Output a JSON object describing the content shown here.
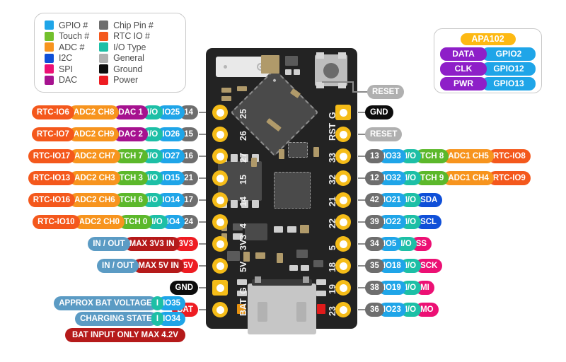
{
  "legend": {
    "left": [
      {
        "label": "GPIO #",
        "color": "#1FA5E8"
      },
      {
        "label": "Touch #",
        "color": "#72C02C"
      },
      {
        "label": "ADC #",
        "color": "#F7941E"
      },
      {
        "label": "I2C",
        "color": "#0F4FD8"
      },
      {
        "label": "SPI",
        "color": "#EC1074"
      },
      {
        "label": "DAC",
        "color": "#A6128F"
      }
    ],
    "right": [
      {
        "label": "Chip Pin #",
        "color": "#6E6E6E"
      },
      {
        "label": "RTC IO #",
        "color": "#F4581C"
      },
      {
        "label": "I/O Type",
        "color": "#1DBFA6"
      },
      {
        "label": "General",
        "color": "#B0B0B0"
      },
      {
        "label": "Ground",
        "color": "#0d0d0d"
      },
      {
        "label": "Power",
        "color": "#EE1C22"
      }
    ]
  },
  "apa102": {
    "title": "APA102",
    "rows": [
      {
        "signal": "DATA",
        "gpio": "GPIO2"
      },
      {
        "signal": "CLK",
        "gpio": "GPIO12"
      },
      {
        "signal": "PWR",
        "gpio": "GPIO13"
      }
    ]
  },
  "board": {
    "reset_callout": "RESET",
    "left_pin_labels": [
      "25",
      "26",
      "27",
      "15",
      "14",
      "4",
      "3V3",
      "5V",
      "G",
      "BAT"
    ],
    "right_pin_labels": [
      "G",
      "RST",
      "33",
      "32",
      "21",
      "22",
      "5",
      "18",
      "19",
      "23"
    ]
  },
  "left_rows": [
    {
      "chips": [
        {
          "t": "RTC-IO6",
          "c": "c-rtc"
        },
        {
          "t": "ADC2 CH8",
          "c": "c-adc"
        },
        {
          "t": "DAC 1",
          "c": "c-dac"
        },
        {
          "t": "I/O",
          "c": "c-io"
        },
        {
          "t": "IO25",
          "c": "c-gpio"
        },
        {
          "t": "14",
          "c": "c-pin"
        }
      ]
    },
    {
      "chips": [
        {
          "t": "RTC-IO7",
          "c": "c-rtc"
        },
        {
          "t": "ADC2 CH9",
          "c": "c-adc"
        },
        {
          "t": "DAC 2",
          "c": "c-dac"
        },
        {
          "t": "I/O",
          "c": "c-io"
        },
        {
          "t": "IO26",
          "c": "c-gpio"
        },
        {
          "t": "15",
          "c": "c-pin"
        }
      ]
    },
    {
      "chips": [
        {
          "t": "RTC-IO17",
          "c": "c-rtc"
        },
        {
          "t": "ADC2 CH7",
          "c": "c-adc"
        },
        {
          "t": "TCH 7",
          "c": "c-tch"
        },
        {
          "t": "I/O",
          "c": "c-io"
        },
        {
          "t": "IO27",
          "c": "c-gpio"
        },
        {
          "t": "16",
          "c": "c-pin"
        }
      ]
    },
    {
      "chips": [
        {
          "t": "RTC-IO13",
          "c": "c-rtc"
        },
        {
          "t": "ADC2 CH3",
          "c": "c-adc"
        },
        {
          "t": "TCH 3",
          "c": "c-tch"
        },
        {
          "t": "I/O",
          "c": "c-io"
        },
        {
          "t": "IO15",
          "c": "c-gpio"
        },
        {
          "t": "21",
          "c": "c-pin"
        }
      ]
    },
    {
      "chips": [
        {
          "t": "RTC-IO16",
          "c": "c-rtc"
        },
        {
          "t": "ADC2 CH6",
          "c": "c-adc"
        },
        {
          "t": "TCH 6",
          "c": "c-tch"
        },
        {
          "t": "I/O",
          "c": "c-io"
        },
        {
          "t": "IO14",
          "c": "c-gpio"
        },
        {
          "t": "17",
          "c": "c-pin"
        }
      ]
    },
    {
      "chips": [
        {
          "t": "RTC-IO10",
          "c": "c-rtc"
        },
        {
          "t": "ADC2 CH0",
          "c": "c-adc"
        },
        {
          "t": "TCH 0",
          "c": "c-tch"
        },
        {
          "t": "I/O",
          "c": "c-io"
        },
        {
          "t": "IO4",
          "c": "c-gpio"
        },
        {
          "t": "24",
          "c": "c-pin"
        }
      ]
    },
    {
      "chips": [
        {
          "t": "IN / OUT",
          "c": "c-inout"
        },
        {
          "t": "MAX 3V3 IN",
          "c": "c-pwrdk"
        },
        {
          "t": "3V3",
          "c": "c-pwr"
        }
      ]
    },
    {
      "chips": [
        {
          "t": "IN / OUT",
          "c": "c-inout"
        },
        {
          "t": "MAX 5V IN",
          "c": "c-pwrdk"
        },
        {
          "t": "5V",
          "c": "c-pwr"
        }
      ]
    },
    {
      "chips": [
        {
          "t": "GND",
          "c": "c-gnd"
        }
      ]
    },
    {
      "chips": [
        {
          "t": "BAT",
          "c": "c-pwr"
        }
      ]
    }
  ],
  "left_extra_rows": [
    {
      "chips": [
        {
          "t": "APPROX BAT VOLTAGE",
          "c": "c-inout"
        },
        {
          "t": "I",
          "c": "c-io"
        },
        {
          "t": "IO35",
          "c": "c-gpio"
        }
      ]
    },
    {
      "chips": [
        {
          "t": "CHARGING STATE",
          "c": "c-inout"
        },
        {
          "t": "I",
          "c": "c-io"
        },
        {
          "t": "IO34",
          "c": "c-gpio"
        }
      ]
    }
  ],
  "bat_note": "BAT INPUT ONLY MAX 4.2V",
  "right_rows": [
    {
      "chips": [
        {
          "t": "GND",
          "c": "c-gnd"
        }
      ]
    },
    {
      "chips": [
        {
          "t": "RESET",
          "c": "c-gen"
        }
      ]
    },
    {
      "chips": [
        {
          "t": "13",
          "c": "c-pin"
        },
        {
          "t": "IO33",
          "c": "c-gpio"
        },
        {
          "t": "I/O",
          "c": "c-io"
        },
        {
          "t": "TCH 8",
          "c": "c-tch"
        },
        {
          "t": "ADC1 CH5",
          "c": "c-adc"
        },
        {
          "t": "RTC-IO8",
          "c": "c-rtc"
        }
      ]
    },
    {
      "chips": [
        {
          "t": "12",
          "c": "c-pin"
        },
        {
          "t": "IO32",
          "c": "c-gpio"
        },
        {
          "t": "I/O",
          "c": "c-io"
        },
        {
          "t": "TCH 9",
          "c": "c-tch"
        },
        {
          "t": "ADC1 CH4",
          "c": "c-adc"
        },
        {
          "t": "RTC-IO9",
          "c": "c-rtc"
        }
      ]
    },
    {
      "chips": [
        {
          "t": "42",
          "c": "c-pin"
        },
        {
          "t": "IO21",
          "c": "c-gpio"
        },
        {
          "t": "I/O",
          "c": "c-io"
        },
        {
          "t": "SDA",
          "c": "c-i2c"
        }
      ]
    },
    {
      "chips": [
        {
          "t": "39",
          "c": "c-pin"
        },
        {
          "t": "IO22",
          "c": "c-gpio"
        },
        {
          "t": "I/O",
          "c": "c-io"
        },
        {
          "t": "SCL",
          "c": "c-i2c"
        }
      ]
    },
    {
      "chips": [
        {
          "t": "34",
          "c": "c-pin"
        },
        {
          "t": "IO5",
          "c": "c-gpio"
        },
        {
          "t": "I/O",
          "c": "c-io"
        },
        {
          "t": "SS",
          "c": "c-spi"
        }
      ]
    },
    {
      "chips": [
        {
          "t": "35",
          "c": "c-pin"
        },
        {
          "t": "IO18",
          "c": "c-gpio"
        },
        {
          "t": "I/O",
          "c": "c-io"
        },
        {
          "t": "SCK",
          "c": "c-spi"
        }
      ]
    },
    {
      "chips": [
        {
          "t": "38",
          "c": "c-pin"
        },
        {
          "t": "IO19",
          "c": "c-gpio"
        },
        {
          "t": "I/O",
          "c": "c-io"
        },
        {
          "t": "MI",
          "c": "c-spi"
        }
      ]
    },
    {
      "chips": [
        {
          "t": "36",
          "c": "c-pin"
        },
        {
          "t": "IO23",
          "c": "c-gpio"
        },
        {
          "t": "I/O",
          "c": "c-io"
        },
        {
          "t": "MO",
          "c": "c-spi"
        }
      ]
    }
  ]
}
